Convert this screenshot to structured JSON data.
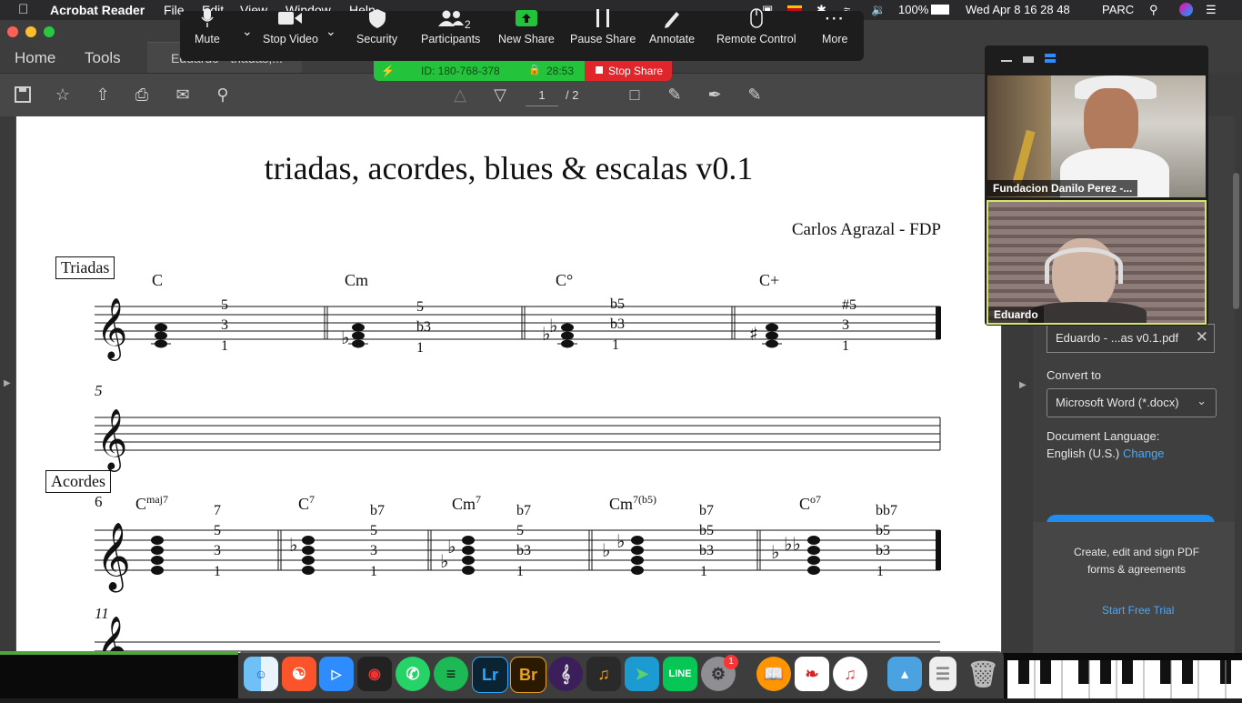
{
  "menubar": {
    "app_name": "Acrobat Reader",
    "menus": [
      "File",
      "Edit",
      "View",
      "Window",
      "Help"
    ],
    "battery": "100%",
    "datetime": "Wed Apr 8  16 28 48",
    "user": "PARC"
  },
  "acrobat": {
    "tabs": {
      "home": "Home",
      "tools": "Tools",
      "document": "Eduardo - triadas,..."
    },
    "page_current": "1",
    "page_total": "/ 2"
  },
  "document": {
    "title": "triadas, acordes, blues & escalas v0.1",
    "author": "Carlos Agrazal - FDP",
    "sections": {
      "triads": "Triadas",
      "chords": "Acordes"
    },
    "bar_numbers": [
      "5",
      "6",
      "11"
    ],
    "triads": [
      {
        "name": "C",
        "intervals": [
          "5",
          "3",
          "1"
        ]
      },
      {
        "name": "Cm",
        "intervals": [
          "5",
          "b3",
          "1"
        ]
      },
      {
        "name": "C°",
        "intervals": [
          "b5",
          "b3",
          "1"
        ]
      },
      {
        "name": "C+",
        "intervals": [
          "#5",
          "3",
          "1"
        ]
      }
    ],
    "chords": [
      {
        "name": "C",
        "sup": "maj7",
        "intervals": [
          "7",
          "5",
          "3",
          "1"
        ]
      },
      {
        "name": "C",
        "sup": "7",
        "intervals": [
          "b7",
          "5",
          "3",
          "1"
        ]
      },
      {
        "name": "Cm",
        "sup": "7",
        "intervals": [
          "b7",
          "5",
          "b3",
          "1"
        ]
      },
      {
        "name": "Cm",
        "sup": "7(b5)",
        "intervals": [
          "b7",
          "b5",
          "b3",
          "1"
        ]
      },
      {
        "name": "C",
        "sup": "o7",
        "intervals": [
          "bb7",
          "b5",
          "b3",
          "1"
        ]
      }
    ]
  },
  "right_pane": {
    "file_name": "Eduardo - ...as v0.1.pdf",
    "convert_label": "Convert to",
    "convert_value": "Microsoft Word (*.docx)",
    "language_label": "Document Language:",
    "language_value": "English (U.S.)",
    "change_link": "Change",
    "promo_text": "Create, edit and sign PDF forms & agreements",
    "trial_link": "Start Free Trial"
  },
  "zoom": {
    "buttons": [
      "Mute",
      "Stop Video",
      "Security",
      "Participants",
      "New Share",
      "Pause Share",
      "Annotate",
      "Remote Control",
      "More"
    ],
    "participants_count": "2",
    "meeting_id": "ID: 180-768-378",
    "elapsed": "28:53",
    "stop_share": "Stop Share",
    "videos": [
      "Fundacion Danilo Perez -...",
      "Eduardo"
    ]
  },
  "dock": {
    "apps": [
      "Finder",
      "Brave",
      "Zoom",
      "Photo Booth",
      "WhatsApp",
      "Spotify",
      "Lightroom",
      "Bridge",
      "MuseScore",
      "GarageBand",
      "Migrate",
      "LINE",
      "System Preferences",
      "iBooks",
      "Acrobat",
      "Music",
      "Downloads",
      "Documents",
      "Trash"
    ],
    "badges": {
      "sysprefs": "1"
    },
    "lr_label": "Lr",
    "br_label": "Br"
  },
  "colors": {
    "zoom_green": "#23c33c",
    "zoom_red": "#e0262b",
    "accent_blue": "#1f8df0",
    "speaker_border": "#d5e56b"
  }
}
